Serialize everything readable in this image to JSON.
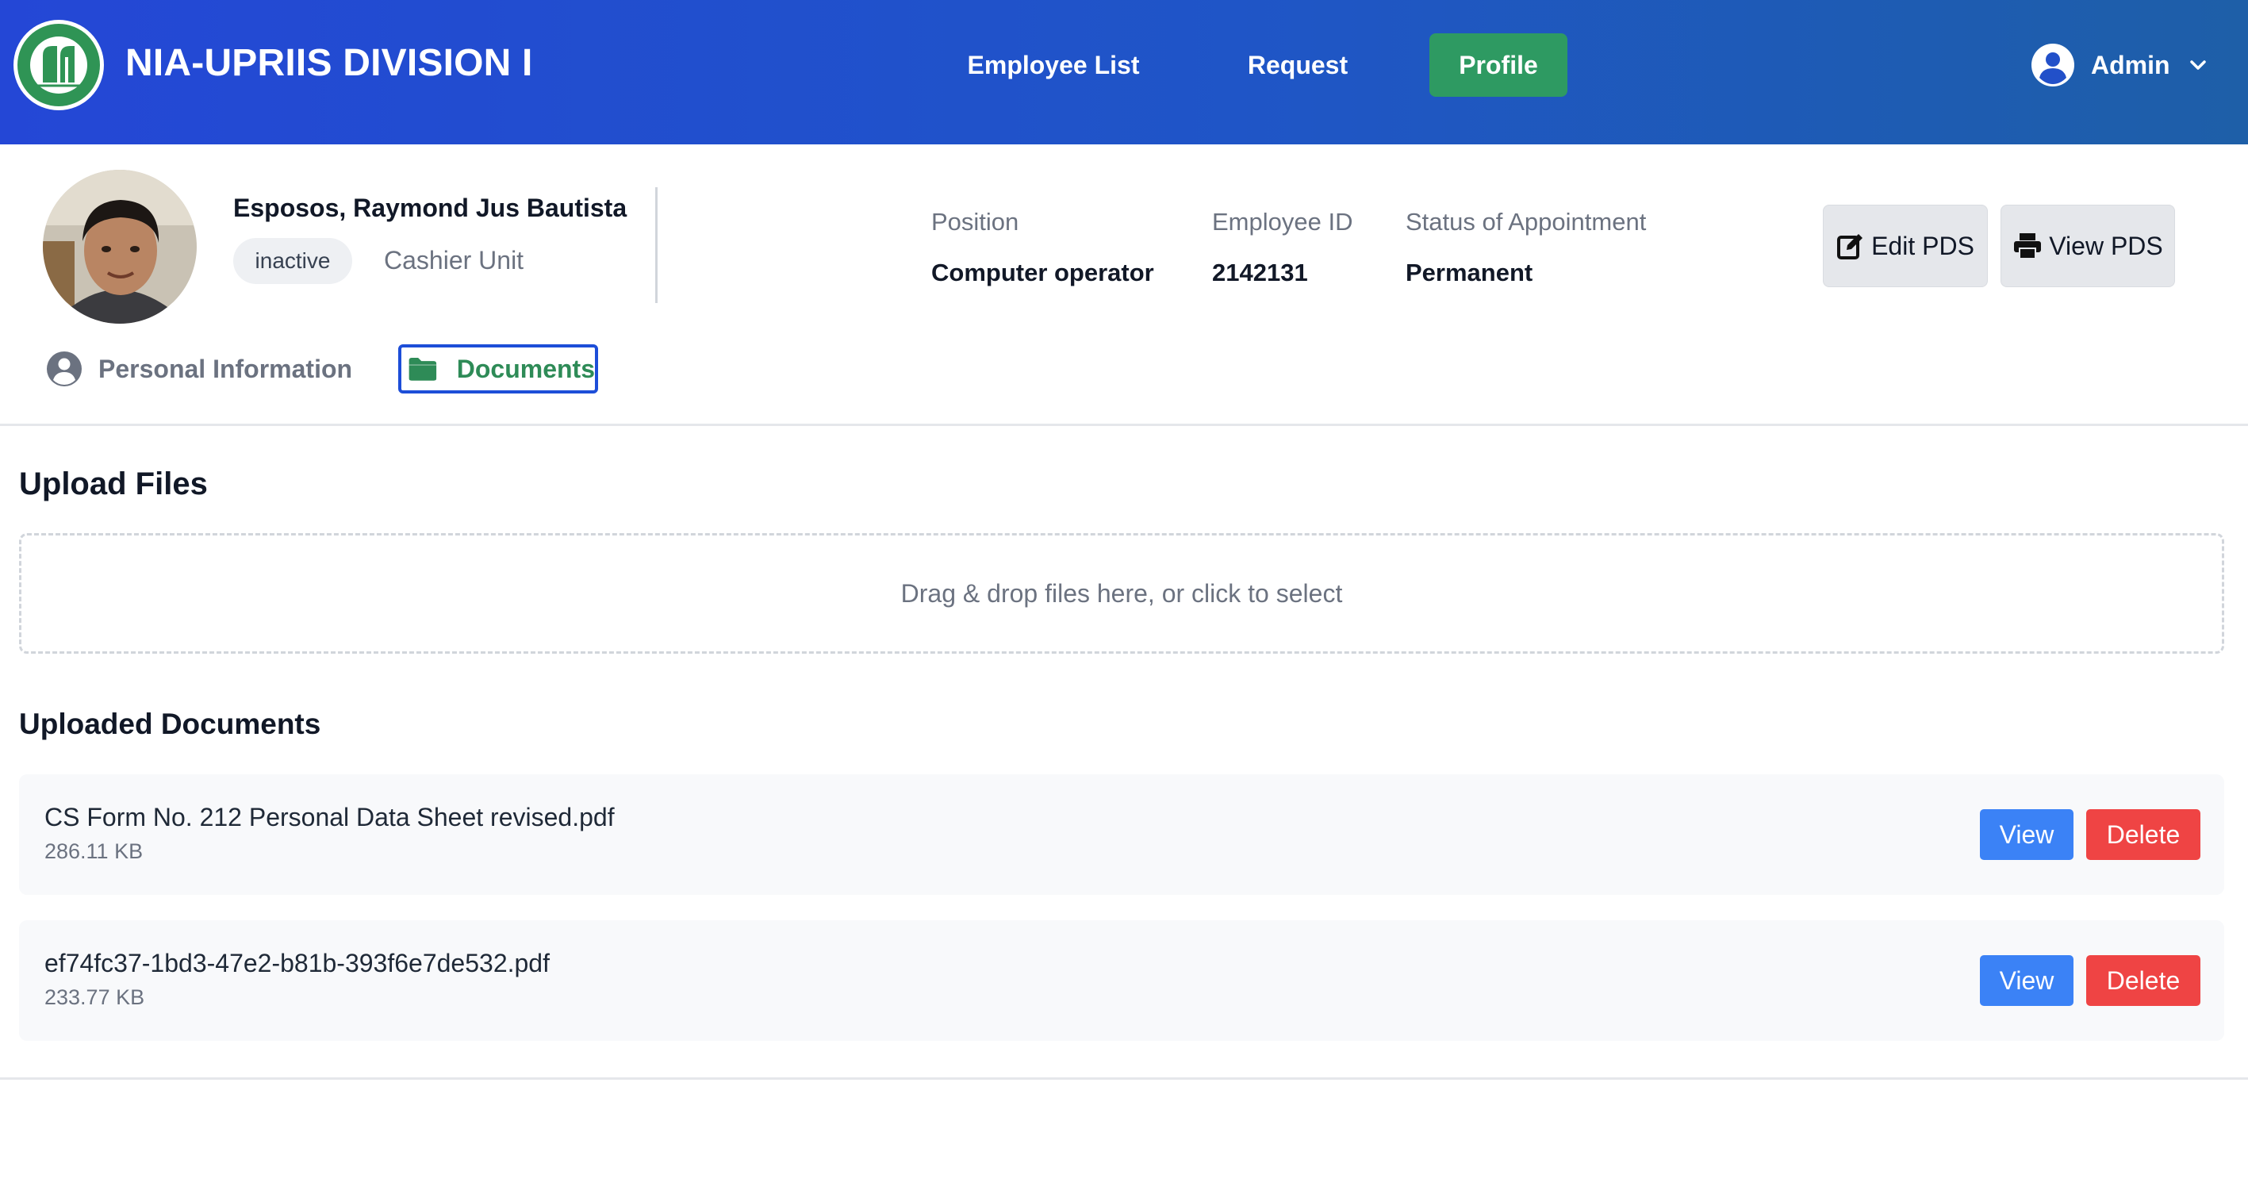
{
  "header": {
    "brand": "NIA-UPRIIS DIVISION I",
    "nav": [
      {
        "label": "Employee List"
      },
      {
        "label": "Request"
      },
      {
        "label": "Profile",
        "active": true
      }
    ],
    "user": {
      "name": "Admin"
    }
  },
  "profile": {
    "name": "Esposos, Raymond Jus Bautista",
    "status": "inactive",
    "unit": "Cashier Unit",
    "fields": [
      {
        "label": "Position",
        "value": "Computer operator"
      },
      {
        "label": "Employee ID",
        "value": "2142131"
      },
      {
        "label": "Status of Appointment",
        "value": "Permanent"
      }
    ],
    "actions": {
      "edit": "Edit PDS",
      "view": "View PDS"
    }
  },
  "tabs": [
    {
      "label": "Personal Information",
      "active": false
    },
    {
      "label": "Documents",
      "active": true
    }
  ],
  "upload": {
    "title": "Upload Files",
    "dropzone": "Drag & drop files here, or click to select"
  },
  "documents": {
    "title": "Uploaded Documents",
    "items": [
      {
        "name": "CS Form No. 212 Personal Data Sheet revised.pdf",
        "size": "286.11 KB",
        "view": "View",
        "delete": "Delete"
      },
      {
        "name": "ef74fc37-1bd3-47e2-b81b-393f6e7de532.pdf",
        "size": "233.77 KB",
        "view": "View",
        "delete": "Delete"
      }
    ]
  },
  "colors": {
    "header_start": "#2447d6",
    "header_end": "#1e5fa8",
    "active_nav": "#2e9a62",
    "view_button": "#3b82f6",
    "delete_button": "#ef4444",
    "documents_tab_border": "#1d4ed8"
  }
}
